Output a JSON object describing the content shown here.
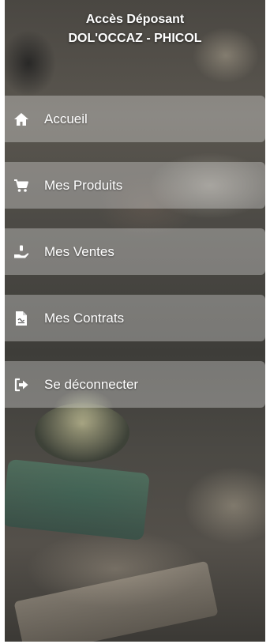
{
  "header": {
    "title": "Accès Déposant",
    "subtitle": "DOL'OCCAZ - PHICOL"
  },
  "menu": {
    "items": [
      {
        "label": "Accueil",
        "icon": "home-icon"
      },
      {
        "label": "Mes Produits",
        "icon": "cart-icon"
      },
      {
        "label": "Mes Ventes",
        "icon": "hand-money-icon"
      },
      {
        "label": "Mes Contrats",
        "icon": "contract-document-icon"
      },
      {
        "label": "Se déconnecter",
        "icon": "logout-icon"
      }
    ]
  },
  "colors": {
    "text": "#ffffff",
    "item_background": "rgba(255,255,255,0.30)"
  }
}
